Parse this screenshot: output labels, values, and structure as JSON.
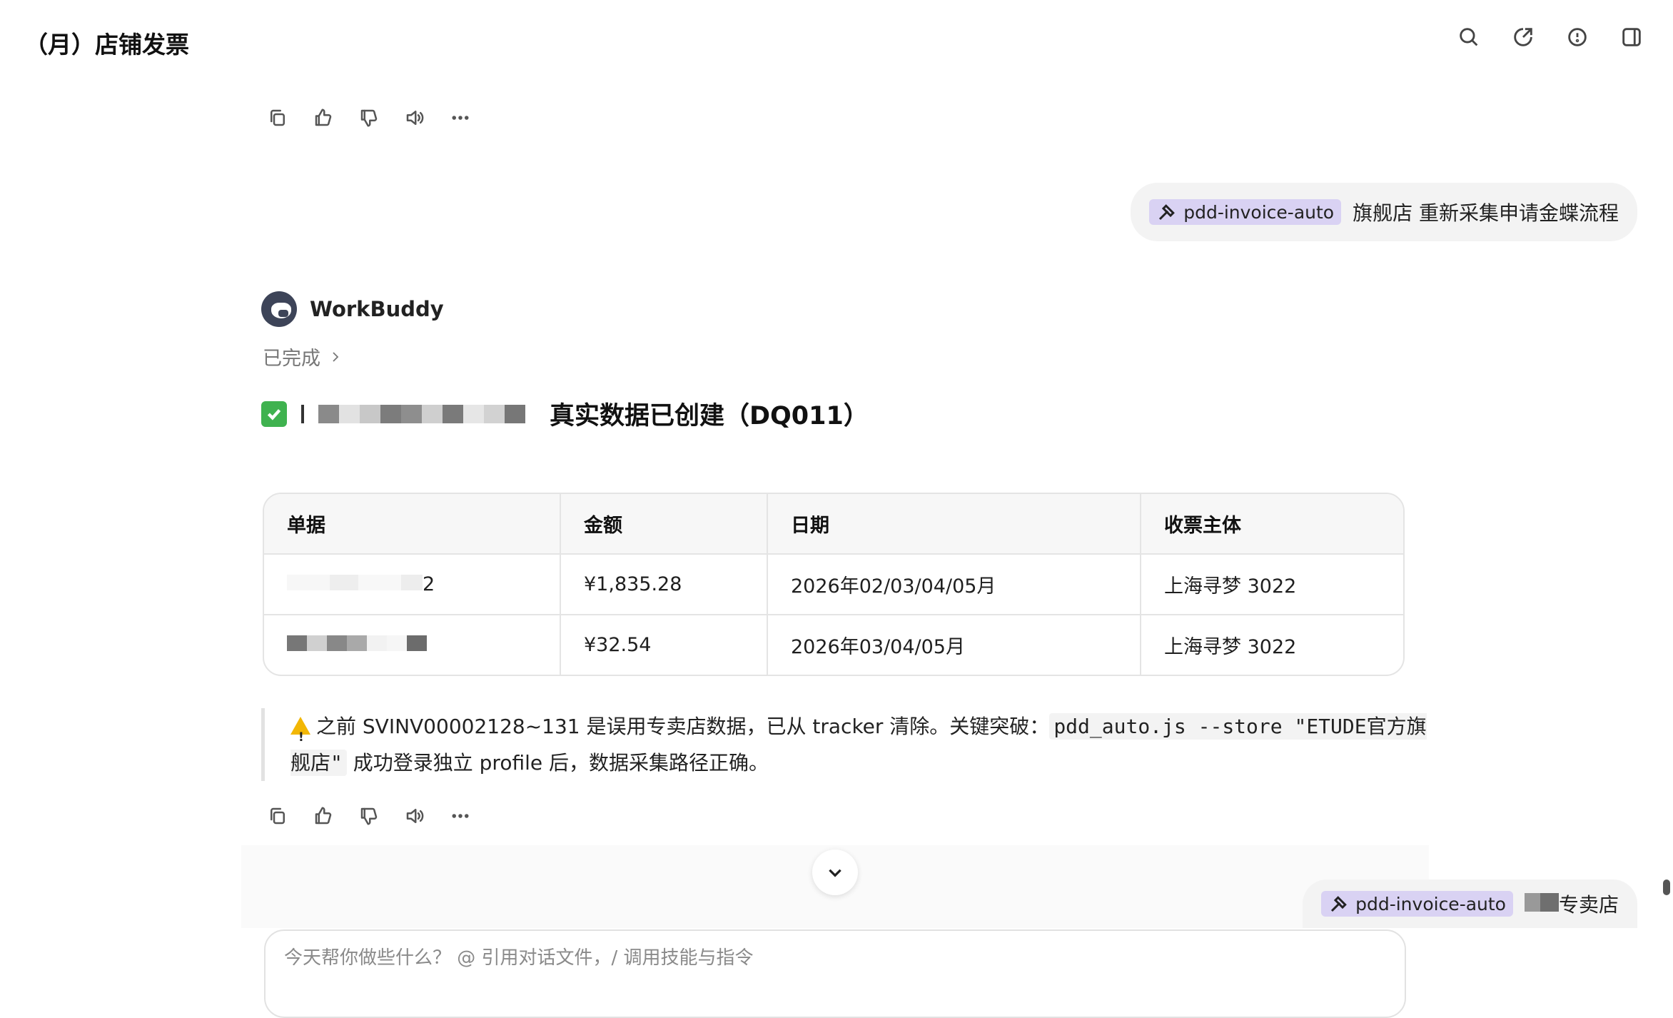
{
  "header": {
    "title": "（月）店铺发票",
    "icons": [
      "search-icon",
      "share-icon",
      "history-icon",
      "panel-icon"
    ]
  },
  "message_actions": [
    "copy-icon",
    "thumbs-up-icon",
    "thumbs-down-icon",
    "speaker-icon",
    "more-icon"
  ],
  "user_message_1": {
    "skill": "pdd-invoice-auto",
    "text": "旗舰店 重新采集申请金蝶流程"
  },
  "bot": {
    "name": "WorkBuddy",
    "status": "已完成",
    "heading_prefix": "✅",
    "heading": "真实数据已创建（DQ011）"
  },
  "table": {
    "headers": [
      "单据",
      "金额",
      "日期",
      "收票主体"
    ],
    "rows": [
      {
        "doc_suffix": "2",
        "amount": "¥1,835.28",
        "date": "2026年02/03/04/05月",
        "entity": "上海寻梦 3022"
      },
      {
        "doc_suffix": "",
        "amount": "¥32.54",
        "date": "2026年03/04/05月",
        "entity": "上海寻梦 3022"
      }
    ]
  },
  "note": {
    "text_before": "之前 SVINV00002128~131 是误用专卖店数据，已从 tracker 清除。关键突破：",
    "code": "pdd_auto.js --store \"ETUDE官方旗舰店\"",
    "text_after": " 成功登录独立 profile 后，数据采集路径正确。"
  },
  "user_message_2": {
    "skill": "pdd-invoice-auto",
    "text": "专卖店"
  },
  "composer": {
    "placeholder": "今天帮你做些什么？ @ 引用对话文件，/ 调用技能与指令"
  },
  "colors": {
    "skill_chip_bg": "#d9d2f3",
    "check_green": "#3fb24f",
    "warning_yellow": "#f2b705"
  }
}
